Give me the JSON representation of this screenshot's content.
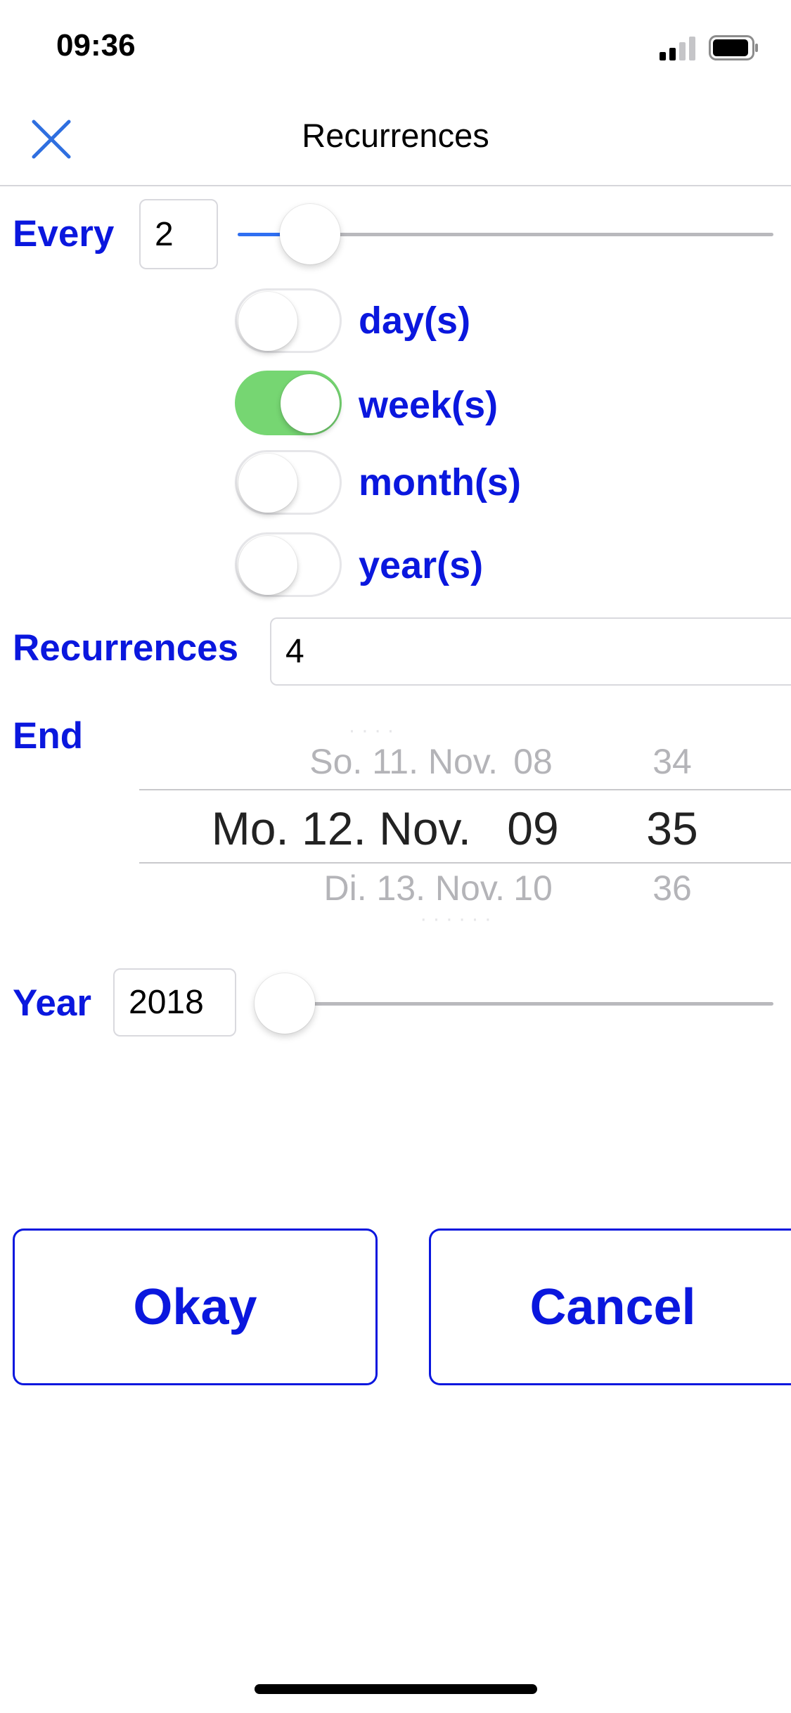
{
  "status_bar": {
    "time": "09:36",
    "signal_icon": "cellular-signal-icon",
    "battery_icon": "battery-icon"
  },
  "nav": {
    "title": "Recurrences",
    "close_icon": "close-icon"
  },
  "every": {
    "label": "Every",
    "value": "2",
    "slider_fraction": 0.07
  },
  "units": [
    {
      "label": "day(s)",
      "on": false
    },
    {
      "label": "week(s)",
      "on": true
    },
    {
      "label": "month(s)",
      "on": false
    },
    {
      "label": "year(s)",
      "on": false
    }
  ],
  "recurrences": {
    "label": "Recurrences",
    "value": "4"
  },
  "end": {
    "label": "End",
    "picker": {
      "prev": {
        "date": "So. 11. Nov.",
        "hour": "08",
        "minute": "34"
      },
      "selected": {
        "date": "Mo. 12. Nov.",
        "hour": "09",
        "minute": "35"
      },
      "next": {
        "date": "Di. 13. Nov.",
        "hour": "10",
        "minute": "36"
      }
    }
  },
  "year": {
    "label": "Year",
    "value": "2018",
    "slider_fraction": 0.0
  },
  "buttons": {
    "okay": "Okay",
    "cancel": "Cancel"
  },
  "colors": {
    "accent_blue": "#0a17de",
    "toggle_on": "#76d672",
    "slider_fill": "#2f6ff2"
  }
}
